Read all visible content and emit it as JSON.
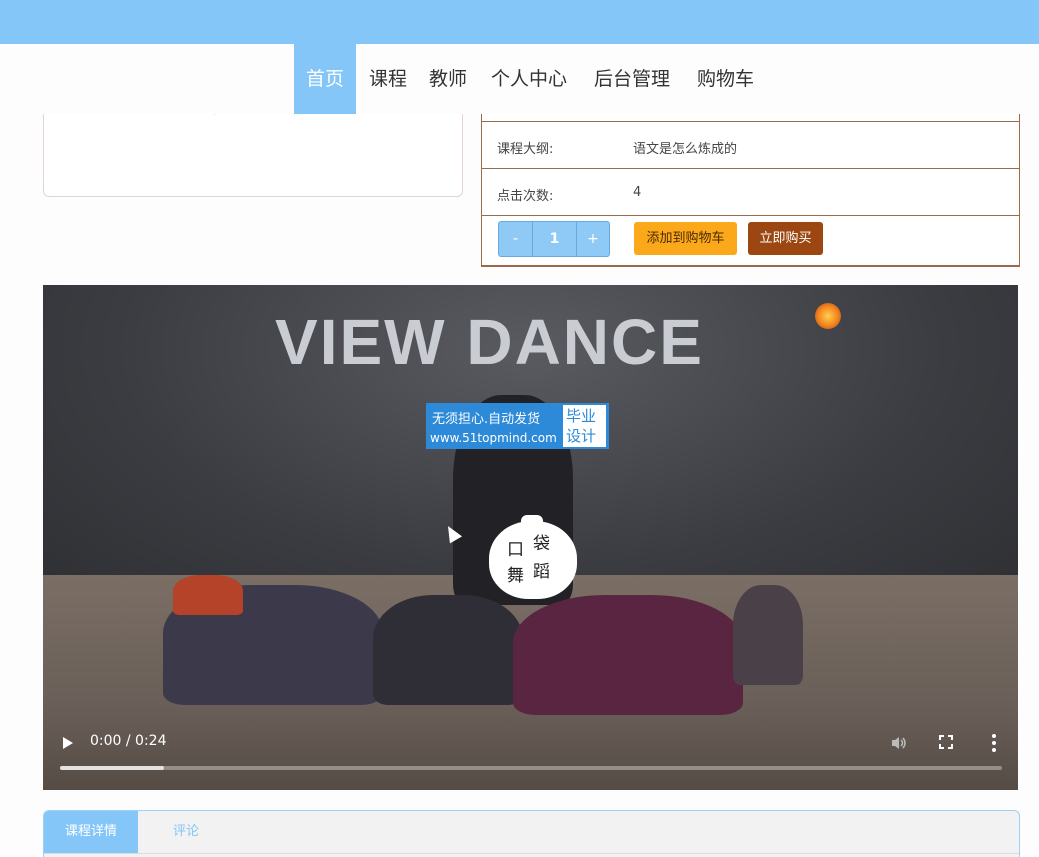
{
  "nav": {
    "items": [
      "首页",
      "课程",
      "教师",
      "个人中心",
      "后台管理",
      "购物车"
    ],
    "active_index": 0,
    "accent_color": "#84c6f7"
  },
  "course_info": {
    "rows": [
      {
        "label": "课程大纲:",
        "value": "语文是怎么炼成的"
      },
      {
        "label": "点击次数:",
        "value": "4"
      }
    ],
    "quantity": {
      "minus_label": "-",
      "value": "1",
      "plus_label": "+"
    },
    "add_to_cart_label": "添加到购物车",
    "buy_now_label": "立即购买"
  },
  "video": {
    "scene_text": "VIEW DANCE",
    "watermark": {
      "line1": "无须担心.自动发货",
      "line2": "www.51topmind.com",
      "side1": "毕业",
      "side2": "设计"
    },
    "logo_chars": [
      "口",
      "袋",
      "舞",
      "蹈"
    ],
    "time_display": "0:00 / 0:24",
    "buffered_fraction": 0.11,
    "icons": [
      "play-icon",
      "volume-icon",
      "fullscreen-icon",
      "more-options-icon"
    ]
  },
  "tabs": {
    "items": [
      "课程详情",
      "评论"
    ],
    "active_index": 0
  }
}
